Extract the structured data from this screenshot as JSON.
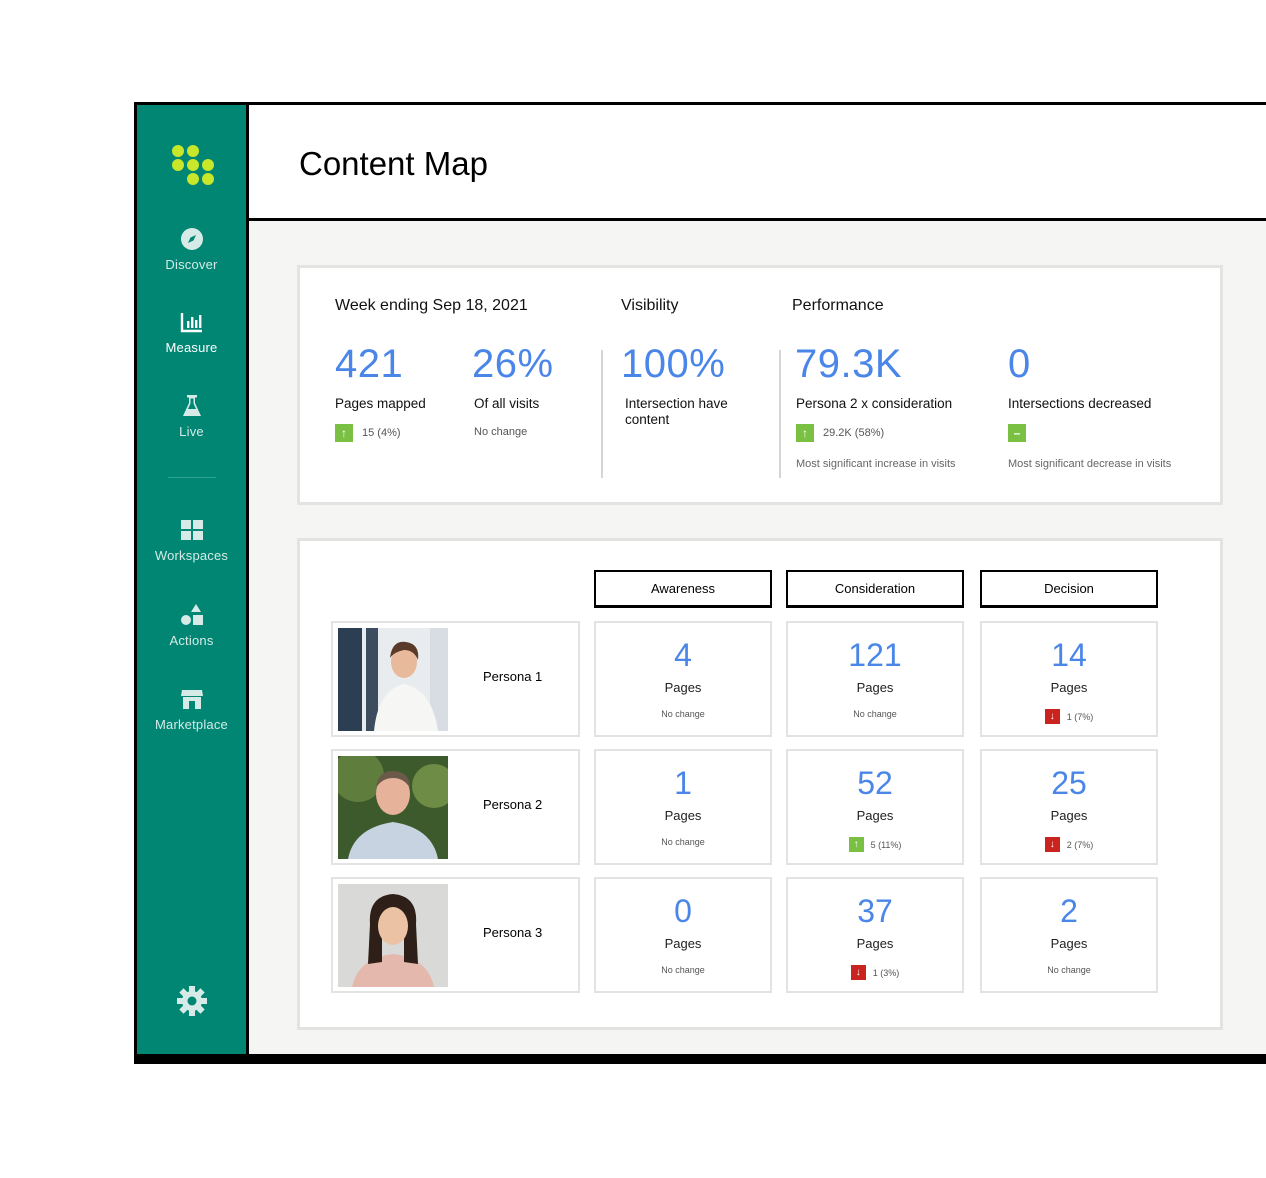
{
  "sidebar": {
    "items": [
      {
        "label": "Discover",
        "icon": "compass-icon"
      },
      {
        "label": "Measure",
        "icon": "bar-chart-icon"
      },
      {
        "label": "Live",
        "icon": "flask-icon"
      },
      {
        "label": "Workspaces",
        "icon": "grid-icon"
      },
      {
        "label": "Actions",
        "icon": "shapes-icon"
      },
      {
        "label": "Marketplace",
        "icon": "store-icon"
      }
    ],
    "active": "Measure",
    "settings_icon": "gear-icon"
  },
  "header": {
    "title": "Content Map"
  },
  "summary": {
    "week": {
      "heading": "Week ending Sep 18, 2021",
      "pages": {
        "value": "421",
        "label": "Pages mapped",
        "change": "15 (4%)",
        "direction": "up"
      },
      "visits": {
        "value": "26%",
        "label": "Of all visits",
        "change": "No change"
      }
    },
    "visibility": {
      "heading": "Visibility",
      "value": "100%",
      "label": "Intersection have content"
    },
    "performance": {
      "heading": "Performance",
      "increase": {
        "value": "79.3K",
        "label": "Persona 2 x consideration",
        "change": "29.2K (58%)",
        "direction": "up",
        "note": "Most significant increase in visits"
      },
      "decrease": {
        "value": "0",
        "label": "Intersections decreased",
        "change_icon": "dash",
        "note": "Most significant decrease in visits"
      }
    }
  },
  "matrix": {
    "columns": [
      "Awareness",
      "Consideration",
      "Decision"
    ],
    "unit": "Pages",
    "rows": [
      {
        "persona": "Persona 1",
        "cells": [
          {
            "value": "4",
            "change": "No change",
            "direction": "none"
          },
          {
            "value": "121",
            "change": "No change",
            "direction": "none"
          },
          {
            "value": "14",
            "change": "1 (7%)",
            "direction": "down"
          }
        ]
      },
      {
        "persona": "Persona 2",
        "cells": [
          {
            "value": "1",
            "change": "No change",
            "direction": "none"
          },
          {
            "value": "52",
            "change": "5 (11%)",
            "direction": "up"
          },
          {
            "value": "25",
            "change": "2 (7%)",
            "direction": "down"
          }
        ]
      },
      {
        "persona": "Persona 3",
        "cells": [
          {
            "value": "0",
            "change": "No change",
            "direction": "none"
          },
          {
            "value": "37",
            "change": "1 (3%)",
            "direction": "down"
          },
          {
            "value": "2",
            "change": "No change",
            "direction": "none"
          }
        ]
      }
    ]
  },
  "colors": {
    "sidebar": "#008673",
    "accent": "#4a86e8",
    "logo": "#c8e62a",
    "up": "#7ac043",
    "down": "#c9241f"
  }
}
